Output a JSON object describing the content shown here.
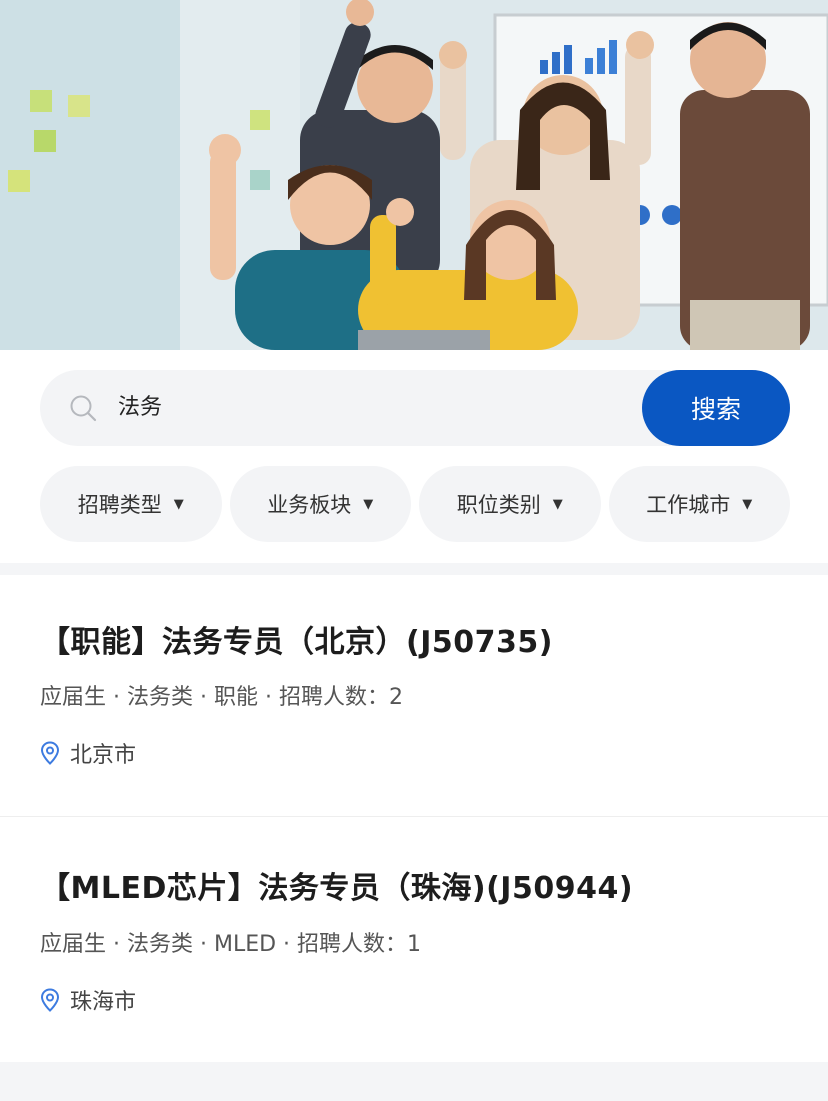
{
  "search": {
    "value": "法务",
    "button_label": "搜索",
    "icon": "search-icon"
  },
  "filters": [
    {
      "label": "招聘类型"
    },
    {
      "label": "业务板块"
    },
    {
      "label": "职位类别"
    },
    {
      "label": "工作城市"
    }
  ],
  "jobs": [
    {
      "title": "【职能】法务专员（北京）(J50735)",
      "meta": "应届生 · 法务类 · 职能 · 招聘人数：2",
      "location": "北京市"
    },
    {
      "title": "【MLED芯片】法务专员（珠海)(J50944)",
      "meta": "应届生 · 法务类 · MLED · 招聘人数：1",
      "location": "珠海市"
    }
  ],
  "colors": {
    "accent": "#0a57c2",
    "pin": "#3d7be0"
  }
}
